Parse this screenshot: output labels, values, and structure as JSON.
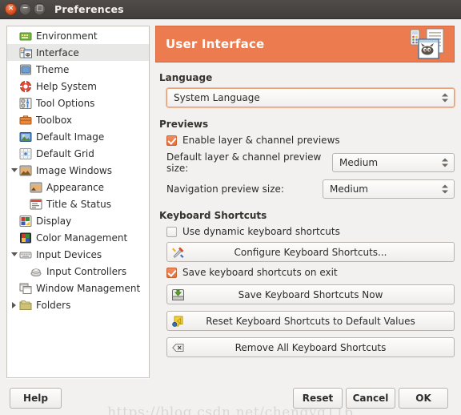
{
  "window": {
    "title": "Preferences",
    "controls": [
      {
        "name": "close",
        "glyph": "×"
      },
      {
        "name": "minimize",
        "glyph": "−"
      },
      {
        "name": "maximize",
        "glyph": "□"
      }
    ]
  },
  "colors": {
    "banner": "#ec7b4f",
    "titlebar": "#413d3a",
    "checkbox_on": "#e2703f",
    "sidebar_selected": "#e8e8e6"
  },
  "sidebar": {
    "items": [
      {
        "label": "Environment",
        "icon": "environment-icon",
        "depth": 0,
        "expander": "none",
        "selected": false
      },
      {
        "label": "Interface",
        "icon": "interface-icon",
        "depth": 0,
        "expander": "none",
        "selected": true
      },
      {
        "label": "Theme",
        "icon": "theme-icon",
        "depth": 0,
        "expander": "none",
        "selected": false
      },
      {
        "label": "Help System",
        "icon": "help-system-icon",
        "depth": 0,
        "expander": "none",
        "selected": false
      },
      {
        "label": "Tool Options",
        "icon": "tool-options-icon",
        "depth": 0,
        "expander": "none",
        "selected": false
      },
      {
        "label": "Toolbox",
        "icon": "toolbox-icon",
        "depth": 0,
        "expander": "none",
        "selected": false
      },
      {
        "label": "Default Image",
        "icon": "default-image-icon",
        "depth": 0,
        "expander": "none",
        "selected": false
      },
      {
        "label": "Default Grid",
        "icon": "default-grid-icon",
        "depth": 0,
        "expander": "none",
        "selected": false
      },
      {
        "label": "Image Windows",
        "icon": "image-windows-icon",
        "depth": 0,
        "expander": "open",
        "selected": false
      },
      {
        "label": "Appearance",
        "icon": "appearance-icon",
        "depth": 1,
        "expander": "none",
        "selected": false
      },
      {
        "label": "Title & Status",
        "icon": "title-status-icon",
        "depth": 1,
        "expander": "none",
        "selected": false
      },
      {
        "label": "Display",
        "icon": "display-icon",
        "depth": 0,
        "expander": "none",
        "selected": false
      },
      {
        "label": "Color Management",
        "icon": "color-management-icon",
        "depth": 0,
        "expander": "none",
        "selected": false
      },
      {
        "label": "Input Devices",
        "icon": "input-devices-icon",
        "depth": 0,
        "expander": "open",
        "selected": false
      },
      {
        "label": "Input Controllers",
        "icon": "input-controllers-icon",
        "depth": 1,
        "expander": "none",
        "selected": false
      },
      {
        "label": "Window Management",
        "icon": "window-management-icon",
        "depth": 0,
        "expander": "none",
        "selected": false
      },
      {
        "label": "Folders",
        "icon": "folders-icon",
        "depth": 0,
        "expander": "closed",
        "selected": false
      }
    ]
  },
  "pane": {
    "banner_title": "User Interface",
    "banner_icon": "user-interface-icon",
    "language": {
      "section_label": "Language",
      "value": "System Language",
      "focused": true
    },
    "previews": {
      "section_label": "Previews",
      "enable_checkbox": {
        "label": "Enable layer & channel previews",
        "checked": true
      },
      "default_size": {
        "label": "Default layer & channel preview size:",
        "value": "Medium"
      },
      "navigation_size": {
        "label": "Navigation preview size:",
        "value": "Medium"
      }
    },
    "keyboard_shortcuts": {
      "section_label": "Keyboard Shortcuts",
      "dynamic_checkbox": {
        "label": "Use dynamic keyboard shortcuts",
        "checked": false
      },
      "configure_button": {
        "label": "Configure Keyboard Shortcuts...",
        "icon": "configure-tools-icon"
      },
      "save_on_exit_checkbox": {
        "label": "Save keyboard shortcuts on exit",
        "checked": true
      },
      "save_now_button": {
        "label": "Save Keyboard Shortcuts Now",
        "icon": "save-icon"
      },
      "reset_button": {
        "label": "Reset Keyboard Shortcuts to Default Values",
        "icon": "reset-icon"
      },
      "remove_all_button": {
        "label": "Remove All Keyboard Shortcuts",
        "icon": "remove-icon"
      }
    }
  },
  "buttons": {
    "help": "Help",
    "reset": "Reset",
    "cancel": "Cancel",
    "ok": "OK"
  },
  "watermark": "https://blog.csdn.net/chengyq116"
}
